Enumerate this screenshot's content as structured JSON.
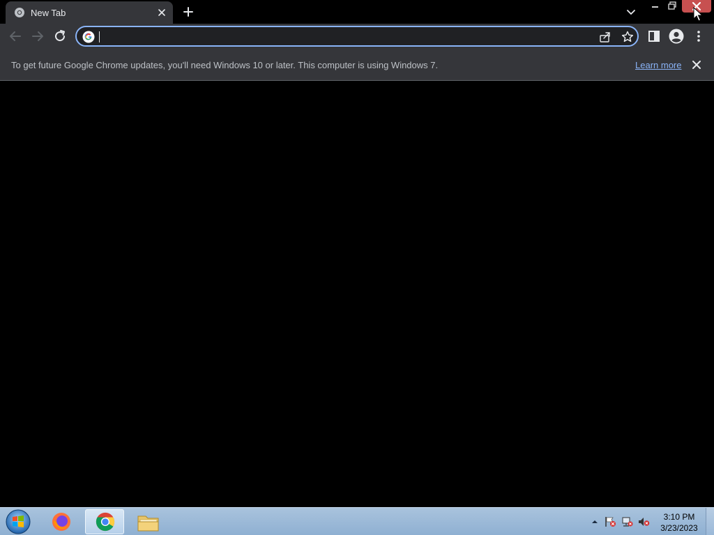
{
  "browser": {
    "tab": {
      "title": "New Tab"
    },
    "omnibox": {
      "value": "",
      "placeholder": ""
    }
  },
  "infobar": {
    "message": "To get future Google Chrome updates, you'll need Windows 10 or later. This computer is using Windows 7.",
    "link": "Learn more"
  },
  "taskbar": {
    "apps": [
      {
        "name": "Firefox",
        "icon": "firefox-icon"
      },
      {
        "name": "Google Chrome",
        "icon": "chrome-icon",
        "active": true
      },
      {
        "name": "Windows Explorer",
        "icon": "folder-icon"
      }
    ],
    "clock": {
      "time": "3:10 PM",
      "date": "3/23/2023"
    }
  },
  "colors": {
    "accent": "#8ab4f8",
    "toolbar": "#35363a",
    "close_hover": "#c75050"
  }
}
